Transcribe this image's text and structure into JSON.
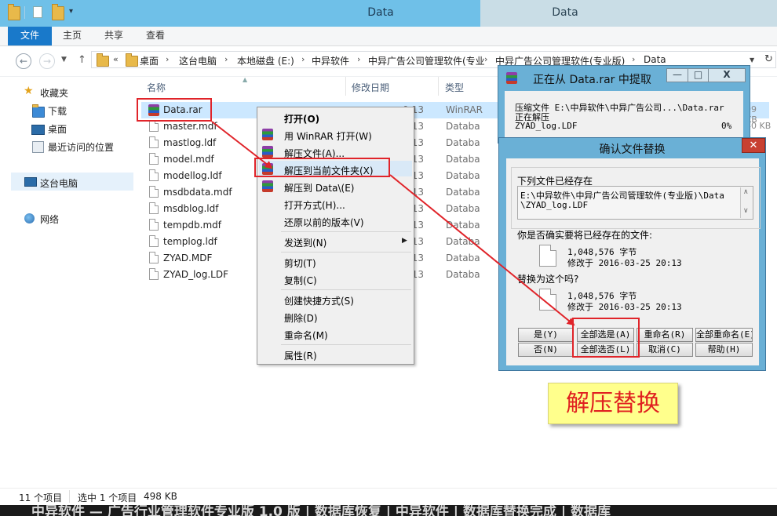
{
  "explorer": {
    "title": "Data",
    "ghost_title": "Data",
    "ribbon_tabs": [
      "文件",
      "主页",
      "共享",
      "查看"
    ],
    "breadcrumb": [
      "桌面",
      "这台电脑",
      "本地磁盘 (E:)",
      "中异软件",
      "中异广告公司管理软件(专业",
      "中异广告公司管理软件(专业版)",
      "Data"
    ],
    "breadcrumb_prefix": "«"
  },
  "navpane": {
    "favorites": "收藏夹",
    "items": [
      "下载",
      "桌面",
      "最近访问的位置"
    ],
    "this_pc": "这台电脑",
    "network": "网络"
  },
  "columns": {
    "name": "名称",
    "modified": "修改日期",
    "type": "类型"
  },
  "files": [
    {
      "name": "Data.rar",
      "time": "0:13",
      "type": "WinRAR",
      "size": "99 KB",
      "kind": "rar"
    },
    {
      "name": "master.mdf",
      "time": "0:13",
      "type": "Databa",
      "size": "40 KB",
      "kind": "doc"
    },
    {
      "name": "mastlog.ldf",
      "time": "0:13",
      "type": "Databa",
      "size": "",
      "kind": "doc"
    },
    {
      "name": "model.mdf",
      "time": "0:13",
      "type": "Databa",
      "size": "",
      "kind": "doc"
    },
    {
      "name": "modellog.ldf",
      "time": "0:13",
      "type": "Databa",
      "size": "",
      "kind": "doc"
    },
    {
      "name": "msdbdata.mdf",
      "time": "0:13",
      "type": "Databa",
      "size": "",
      "kind": "doc"
    },
    {
      "name": "msdblog.ldf",
      "time": "0:13",
      "type": "Databa",
      "size": "",
      "kind": "doc"
    },
    {
      "name": "tempdb.mdf",
      "time": "0:13",
      "type": "Databa",
      "size": "",
      "kind": "doc"
    },
    {
      "name": "templog.ldf",
      "time": "0:13",
      "type": "Databa",
      "size": "",
      "kind": "doc"
    },
    {
      "name": "ZYAD.MDF",
      "time": "0:13",
      "type": "Databa",
      "size": "",
      "kind": "doc"
    },
    {
      "name": "ZYAD_log.LDF",
      "time": "0:13",
      "type": "Databa",
      "size": "",
      "kind": "doc"
    }
  ],
  "status": {
    "count": "11 个项目",
    "selected": "选中 1 个项目",
    "size": "498 KB"
  },
  "context_menu": {
    "open": "打开(O)",
    "open_winrar": "用 WinRAR 打开(W)",
    "extract_files": "解压文件(A)...",
    "extract_here": "解压到当前文件夹(X)",
    "extract_to": "解压到 Data\\(E)",
    "open_with": "打开方式(H)...",
    "restore": "还原以前的版本(V)",
    "send_to": "发送到(N)",
    "cut": "剪切(T)",
    "copy": "复制(C)",
    "shortcut": "创建快捷方式(S)",
    "delete": "删除(D)",
    "rename": "重命名(M)",
    "properties": "属性(R)"
  },
  "rar_progress": {
    "title": "正在从 Data.rar 中提取",
    "archive_label": "压缩文件 E:\\中异软件\\中异广告公司...\\Data.rar",
    "extracting": "正在解压",
    "current_file": "ZYAD_log.LDF",
    "percent": "0%",
    "buttons": [
      "—",
      "□",
      "X"
    ]
  },
  "replace_dialog": {
    "title": "确认文件替换",
    "exists_label": "下列文件已经存在",
    "path_line1": "E:\\中异软件\\中异广告公司管理软件(专业版)\\Data",
    "path_line2": "\\ZYAD_log.LDF",
    "question": "你是否确实要将已经存在的文件:",
    "existing_size": "1,048,576 字节",
    "existing_modified": "修改于 2016-03-25 20:13",
    "replace_with": "替换为这个吗?",
    "new_size": "1,048,576 字节",
    "new_modified": "修改于 2016-03-25 20:13",
    "buttons_row1": [
      "是(Y)",
      "全部选是(A)",
      "重命名(R)",
      "全部重命名(E)"
    ],
    "buttons_row2": [
      "否(N)",
      "全部选否(L)",
      "取消(C)",
      "帮助(H)"
    ]
  },
  "annotation": {
    "caption": "解压替换",
    "color": "#e0242a"
  },
  "footer_overlay": "中异软件 — 广告行业管理软件专业版 1.0 版 | 数据库恢复 | 中异软件 | 数据库替换完成 | 数据库"
}
